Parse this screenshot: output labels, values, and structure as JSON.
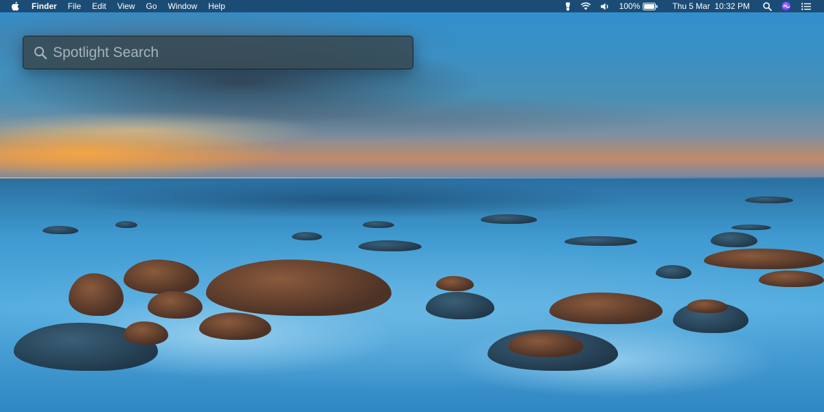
{
  "menubar": {
    "apple_icon": "apple-logo-icon",
    "app_name": "Finder",
    "menus": [
      {
        "label": "File"
      },
      {
        "label": "Edit"
      },
      {
        "label": "View"
      },
      {
        "label": "Go"
      },
      {
        "label": "Window"
      },
      {
        "label": "Help"
      }
    ],
    "status": {
      "icons": [
        "flashlight-icon",
        "wifi-icon",
        "volume-icon",
        "battery-icon",
        "search-icon",
        "siri-icon",
        "notification-center-icon"
      ],
      "battery_percent": "100%",
      "battery_level": 1.0,
      "clock": "Thu 5 Mar  10:32 PM"
    }
  },
  "spotlight": {
    "placeholder": "Spotlight Search",
    "value": ""
  },
  "colors": {
    "menubar_bg": "#19466e",
    "spotlight_bg": "#374850",
    "text_light": "#ffffff"
  }
}
